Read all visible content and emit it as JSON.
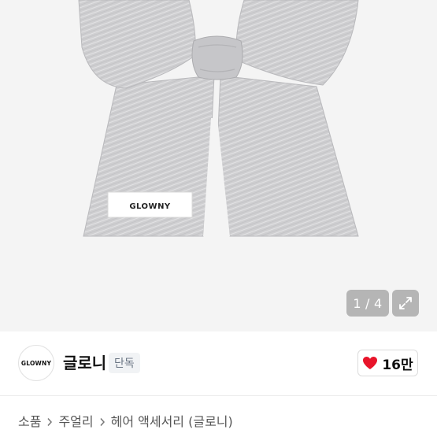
{
  "gallery": {
    "current_page": "1",
    "total_pages": "4",
    "separator": "/",
    "product_label_text": "GLOWNY"
  },
  "shop": {
    "avatar_text": "GLOWNY",
    "name": "글로니",
    "badge": "단독",
    "like_count": "16만"
  },
  "breadcrumb": {
    "items": [
      "소품",
      "주얼리",
      "헤어 액세서리 (글로니)"
    ]
  },
  "colors": {
    "heart": "#e8142a",
    "image_background": "#f4f4f4",
    "badge_text": "#6b7684"
  },
  "icons": {
    "expand": "expand-icon",
    "heart": "heart-icon",
    "chevron": "chevron-right-icon"
  }
}
